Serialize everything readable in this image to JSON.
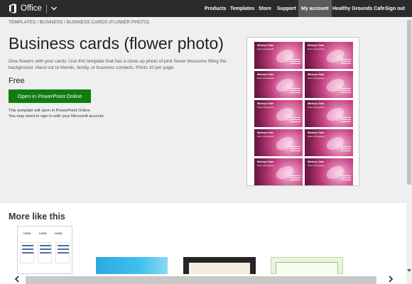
{
  "topbar": {
    "brand": "Office",
    "nav": [
      "Products",
      "Templates",
      "Store",
      "Support",
      "My account",
      "Healthy Grounds Cafe",
      "Sign out"
    ],
    "active": "My account"
  },
  "breadcrumb": "TEMPLATES / BUSINESS / BUSINESS CARDS (FLOWER PHOTO)",
  "title": "Business cards (flower photo)",
  "description": "Give flowers with your cards: Use this template that has a close-up photo of pink flower blossoms filling the background. Hand out to friends, family, or business contacts. Prints 10 per page.",
  "price": "Free",
  "open_button": "Open in PowerPoint Online",
  "note_line1": "This template will open in PowerPoint Online.",
  "note_line2": "You may need to sign in with your Microsoft account.",
  "card": {
    "name": "Mickeys Gate",
    "sub": "flower photography"
  },
  "more_title": "More like this",
  "thumb_logo": "LOGO",
  "colors": {
    "topbar": "#2b2b2b",
    "accent_green": "#107c10",
    "background": "#efefef"
  }
}
